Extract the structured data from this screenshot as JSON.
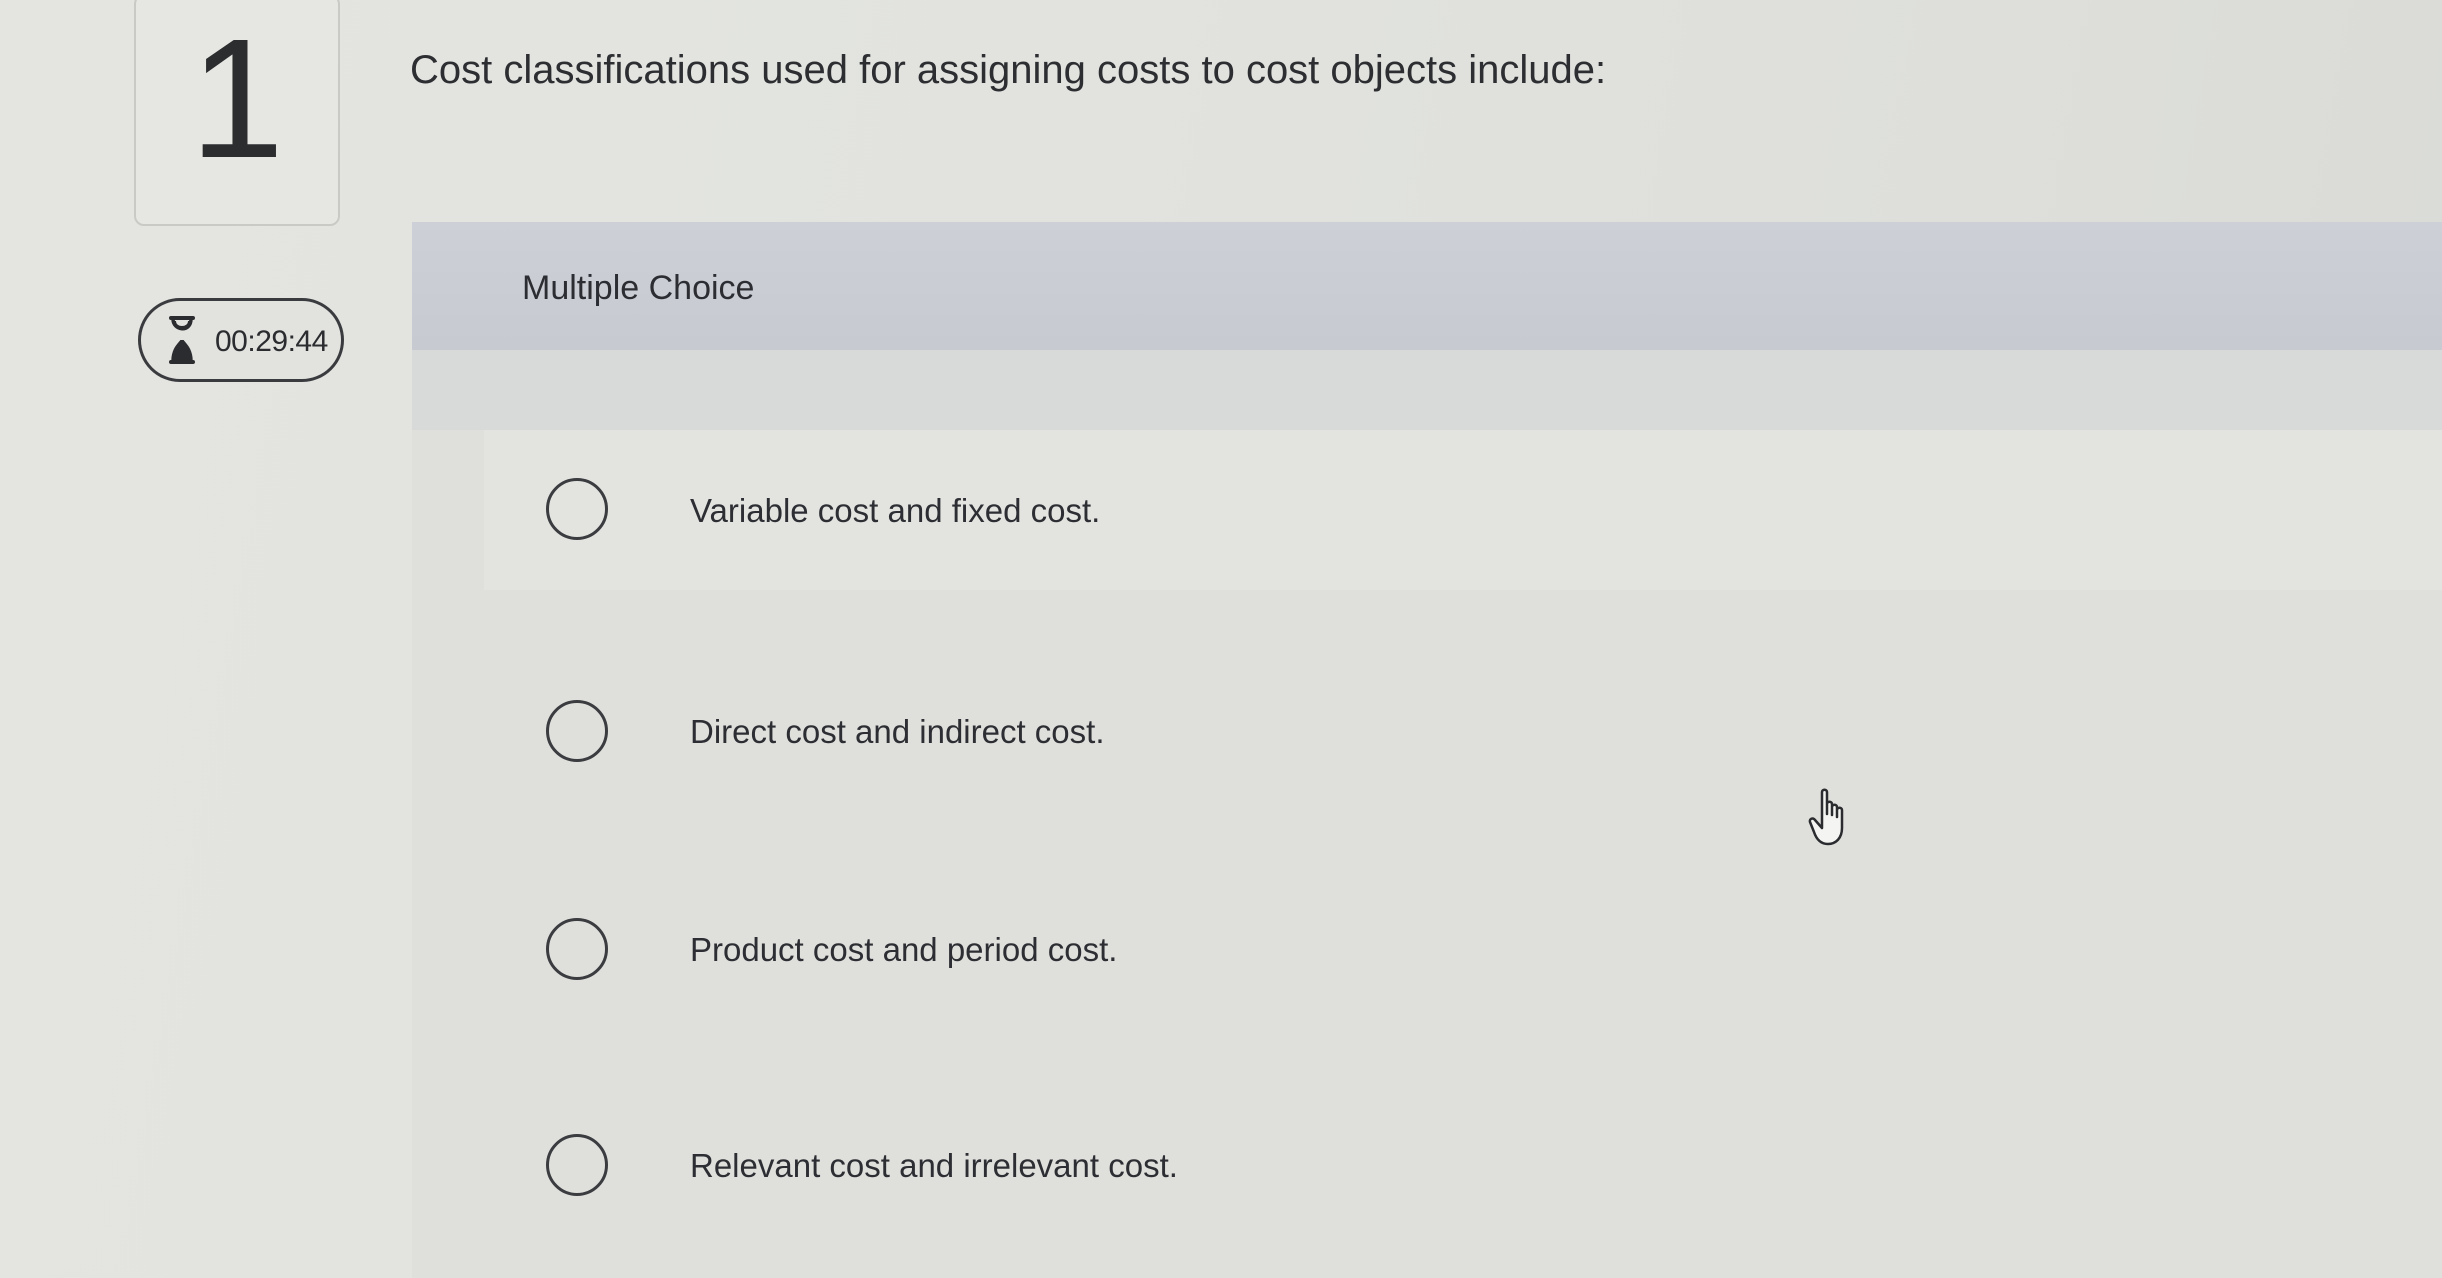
{
  "question": {
    "number": "1",
    "text": "Cost classifications used for assigning costs to cost objects include:"
  },
  "timer": {
    "icon": "hourglass-icon",
    "value": "00:29:44"
  },
  "answer_section": {
    "type_label": "Multiple Choice",
    "options": [
      {
        "label": "Variable cost and fixed cost.",
        "selected": false
      },
      {
        "label": "Direct cost and indirect cost.",
        "selected": false
      },
      {
        "label": "Product cost and period cost.",
        "selected": false
      },
      {
        "label": "Relevant cost and irrelevant cost.",
        "selected": false
      }
    ]
  },
  "cursor": {
    "icon": "pointer-hand-icon"
  }
}
